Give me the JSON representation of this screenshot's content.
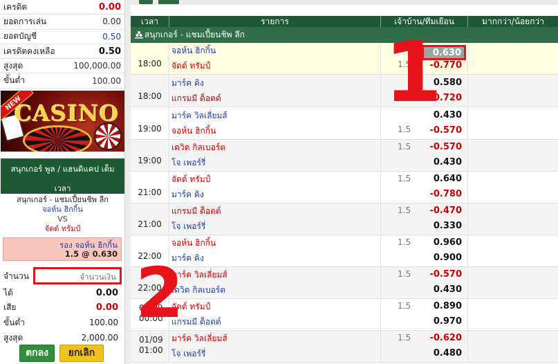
{
  "account": {
    "rows": [
      {
        "label": "เครดิต",
        "value": "0.00",
        "style": "red"
      },
      {
        "label": "ยอดการเล่น",
        "value": "0.00",
        "style": "normal"
      },
      {
        "label": "ยอดบัญชี",
        "value": "0.50",
        "style": "blue"
      },
      {
        "label": "เครดิตคงเหลือ",
        "value": "0.50",
        "style": "bold"
      },
      {
        "label": "สูงสุด",
        "value": "100,000.00",
        "style": "normal"
      },
      {
        "label": "ขั้นต่ำ",
        "value": "100.00",
        "style": "normal"
      }
    ]
  },
  "banner": {
    "tag": "NEW",
    "title": "CASINO"
  },
  "slip": {
    "header_title": "สนุกเกอร์ พูล / แฮนดิแคป เต็ม",
    "header_sub": "เวลา",
    "league": "สนุกเกอร์ - แชมเปี้ยนชิพ ลีก",
    "home": "จอห์น ฮิกกิ้น",
    "vs": "VS",
    "away": "จัดด์ ทรัมป์",
    "pick_line1": "รอง จอห์น ฮิกกิ้น",
    "pick_line2": "1.5 @ 0.630",
    "amount_label": "จำนวน",
    "amount_placeholder": "จำนวนเงิน",
    "win_label": "ได้",
    "win_value": "0.00",
    "lose_label": "เสีย",
    "lose_value": "0.00",
    "min_label": "ขั้นต่ำ",
    "min_value": "100.00",
    "max_label": "สูงสุด",
    "max_value": "2,000.00",
    "confirm_label": "ตกลง",
    "cancel_label": "ยกเลิก"
  },
  "table": {
    "headers": {
      "time": "เวลา",
      "match": "รายการ",
      "hdp": "เจ้าบ้าน/ทีมเยือน",
      "ou": "มากกว่า/น้อยกว่า"
    },
    "league_name": "สนุกเกอร์ - แชมเปี้ยนชิพ ลีก",
    "matches": [
      {
        "date": "",
        "time": "18:00",
        "home": "จอห์น ฮิกกิ้น",
        "home_color": "blue",
        "away": "จัดด์ ทรัมป์",
        "away_color": "red",
        "hdp": "1.5",
        "hdp_row": 2,
        "odd1": "0.630",
        "odd1_color": "dark",
        "odd2": "-0.770",
        "odd2_color": "red",
        "selected": true
      },
      {
        "date": "",
        "time": "18:00",
        "home": "มาร์ค คิง",
        "home_color": "blue",
        "away": "แกรมมี ด็อตต์",
        "away_color": "red",
        "hdp": "1.5",
        "hdp_row": 2,
        "odd1": "0.580",
        "odd1_color": "dark",
        "odd2": "-0.720",
        "odd2_color": "red",
        "selected": false
      },
      {
        "date": "",
        "time": "19:00",
        "home": "มาร์ค วิลเลี่ยมส์",
        "home_color": "blue",
        "away": "จอห์น ฮิกกิ้น",
        "away_color": "red",
        "hdp": "1.5",
        "hdp_row": 2,
        "odd1": "0.430",
        "odd1_color": "dark",
        "odd2": "-0.570",
        "odd2_color": "red",
        "selected": false
      },
      {
        "date": "",
        "time": "19:00",
        "home": "เดวิด กิลเบอร์ต",
        "home_color": "red",
        "away": "โจ เพอร์รี่",
        "away_color": "blue",
        "hdp": "1.5",
        "hdp_row": 1,
        "odd1": "-0.570",
        "odd1_color": "red",
        "odd2": "0.430",
        "odd2_color": "dark",
        "selected": false
      },
      {
        "date": "",
        "time": "21:00",
        "home": "จัดด์ ทรัมป์",
        "home_color": "red",
        "away": "มาร์ค คิง",
        "away_color": "blue",
        "hdp": "1.5",
        "hdp_row": 1,
        "odd1": "0.640",
        "odd1_color": "dark",
        "odd2": "-0.780",
        "odd2_color": "red",
        "selected": false
      },
      {
        "date": "",
        "time": "21:00",
        "home": "แกรมมี ด็อตต์",
        "home_color": "red",
        "away": "โจ เพอร์รี่",
        "away_color": "blue",
        "hdp": "1.5",
        "hdp_row": 1,
        "odd1": "-0.470",
        "odd1_color": "red",
        "odd2": "0.330",
        "odd2_color": "dark",
        "selected": false
      },
      {
        "date": "",
        "time": "22:00",
        "home": "จอห์น ฮิกกิ้น",
        "home_color": "red",
        "away": "มาร์ค คิง",
        "away_color": "blue",
        "hdp": "1.5",
        "hdp_row": 1,
        "odd1": "0.960",
        "odd1_color": "dark",
        "odd2": "0.900",
        "odd2_color": "dark",
        "selected": false
      },
      {
        "date": "",
        "time": "22:00",
        "home": "มาร์ค วิลเลี่ยมส์",
        "home_color": "red",
        "away": "เดวิด กิลเบอร์ต",
        "away_color": "blue",
        "hdp": "1.5",
        "hdp_row": 1,
        "odd1": "-0.570",
        "odd1_color": "red",
        "odd2": "0.430",
        "odd2_color": "dark",
        "selected": false
      },
      {
        "date": "01/09",
        "time": "00:00",
        "home": "จัดด์ ทรัมป์",
        "home_color": "red",
        "away": "แกรมมี ด็อตต์",
        "away_color": "blue",
        "hdp": "1.5",
        "hdp_row": 1,
        "odd1": "0.890",
        "odd1_color": "dark",
        "odd2": "0.970",
        "odd2_color": "dark",
        "selected": false
      },
      {
        "date": "01/09",
        "time": "01:00",
        "home": "มาร์ค วิลเลี่ยมส์",
        "home_color": "red",
        "away": "โจ เพอร์รี่",
        "away_color": "blue",
        "hdp": "1.5",
        "hdp_row": 1,
        "odd1": "-0.620",
        "odd1_color": "red",
        "odd2": "0.480",
        "odd2_color": "dark",
        "selected": false
      }
    ]
  },
  "annotations": {
    "one": "1",
    "two": "2"
  },
  "colors": {
    "header_green": "#1d5a34",
    "league_green": "#2f6e48",
    "red": "#d00000",
    "blue": "#1f3fa8",
    "highlight_border": "#e8121a",
    "pick_bg": "#f8c6bc",
    "button_green": "#2f8f3a",
    "button_yellow": "#f2c21c"
  }
}
